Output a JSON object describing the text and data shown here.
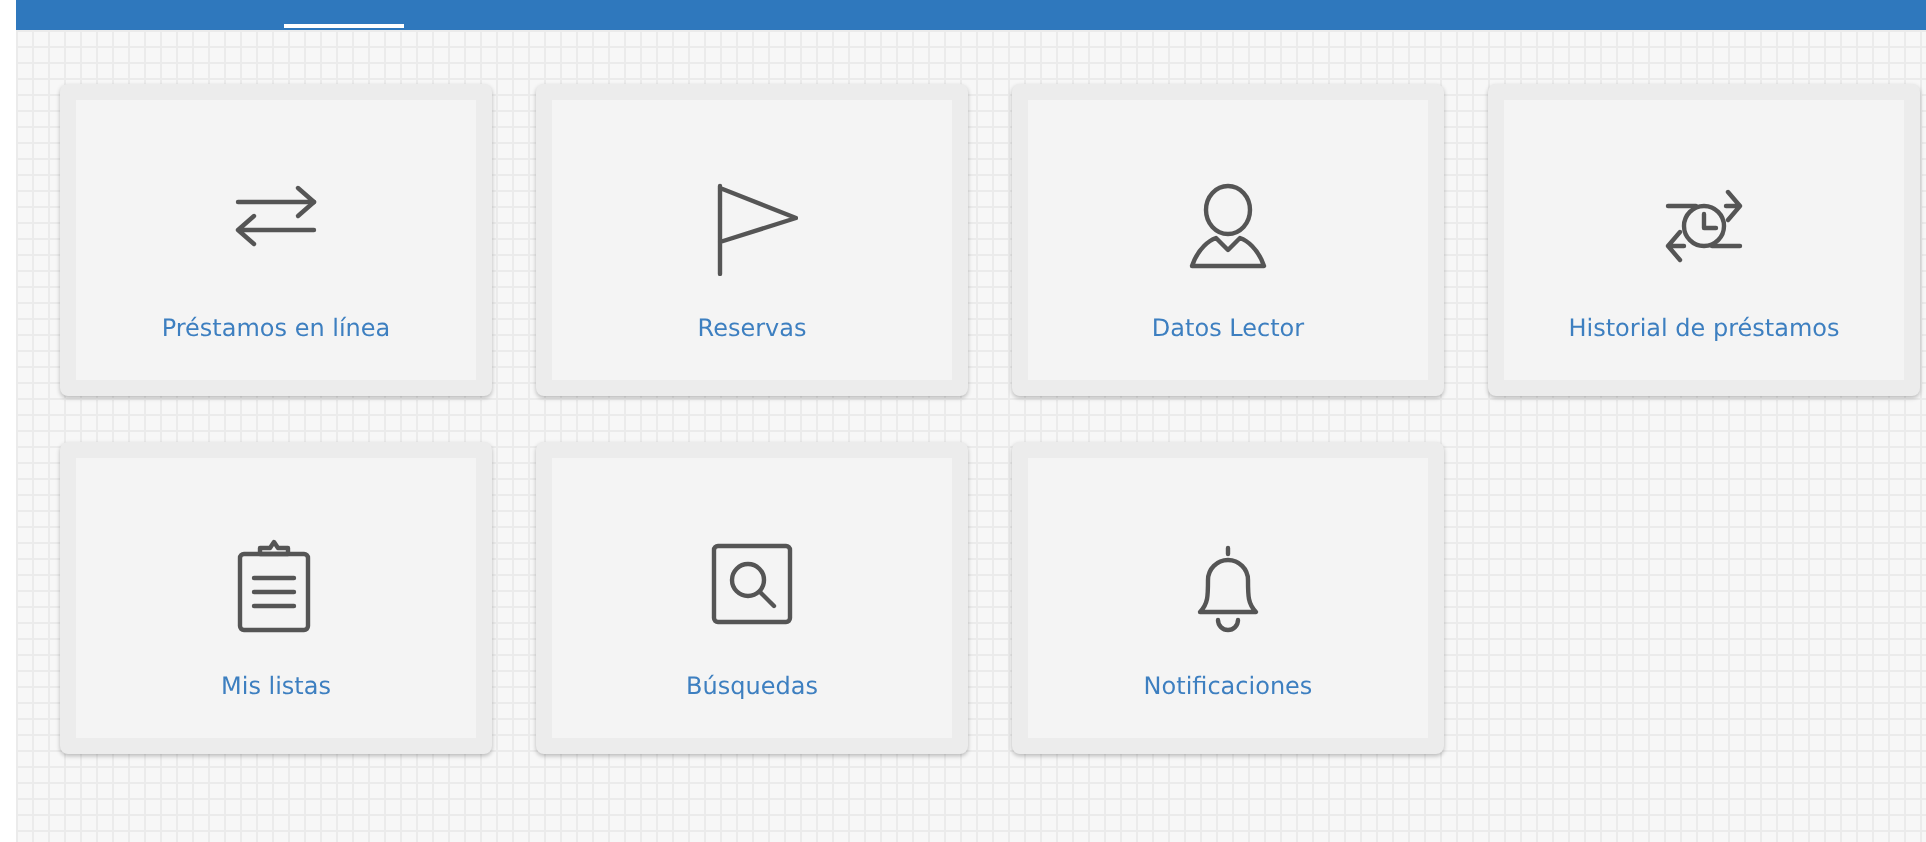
{
  "tiles": [
    {
      "kind": "exchange",
      "label": "Préstamos en línea"
    },
    {
      "kind": "flag",
      "label": "Reservas"
    },
    {
      "kind": "person",
      "label": "Datos Lector"
    },
    {
      "kind": "history",
      "label": "Historial de préstamos"
    },
    {
      "kind": "clipboard",
      "label": "Mis listas"
    },
    {
      "kind": "search",
      "label": "Búsquedas"
    },
    {
      "kind": "bell",
      "label": "Notificaciones"
    }
  ]
}
